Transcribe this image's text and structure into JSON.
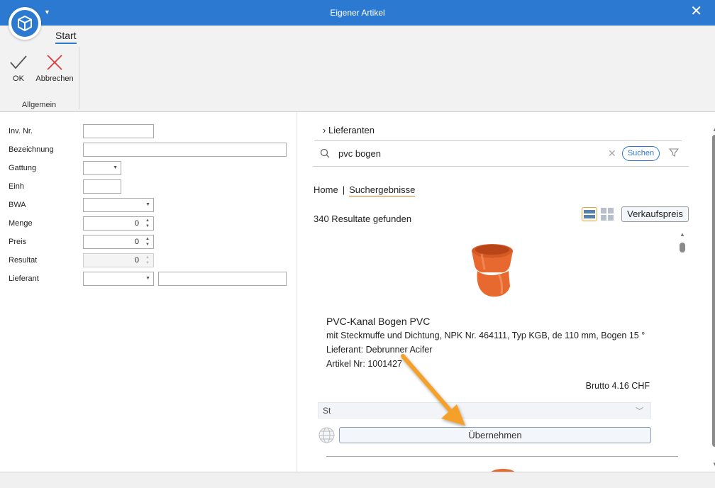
{
  "window": {
    "title": "Eigener Artikel"
  },
  "ribbon": {
    "tab": "Start",
    "ok_label": "OK",
    "cancel_label": "Abbrechen",
    "group_label": "Allgemein"
  },
  "form": {
    "inv_nr": {
      "label": "Inv. Nr.",
      "value": ""
    },
    "bezeichnung": {
      "label": "Bezeichnung",
      "value": ""
    },
    "gattung": {
      "label": "Gattung",
      "value": ""
    },
    "einh": {
      "label": "Einh",
      "value": ""
    },
    "bwa": {
      "label": "BWA",
      "value": ""
    },
    "menge": {
      "label": "Menge",
      "value": "0"
    },
    "preis": {
      "label": "Preis",
      "value": "0"
    },
    "resultat": {
      "label": "Resultat",
      "value": "0"
    },
    "lieferant": {
      "label": "Lieferant",
      "value": "",
      "extra": ""
    }
  },
  "search": {
    "lieferanten_label": "Lieferanten",
    "query": "pvc bogen",
    "button_label": "Suchen"
  },
  "breadcrumb": {
    "home": "Home",
    "separator": "|",
    "current": "Suchergebnisse"
  },
  "results": {
    "count_text": "340 Resultate gefunden",
    "price_mode_label": "Verkaufspreis"
  },
  "product": {
    "name": "PVC-Kanal Bogen PVC",
    "description": "mit Steckmuffe und Dichtung, NPK Nr. 464111, Typ KGB, de 110 mm, Bogen 15 °",
    "supplier": "Lieferant: Debrunner Acifer",
    "article": "Artikel Nr: 1001427",
    "price": "Brutto 4.16 CHF",
    "unit": "St",
    "take_over_label": "Übernehmen"
  },
  "icons": {
    "app": "box-icon",
    "close": "close-icon",
    "ok": "checkmark-icon",
    "cancel": "x-icon",
    "search": "search-icon",
    "filter": "filter-icon",
    "globe": "globe-icon"
  },
  "colors": {
    "accent": "#2b79d0",
    "highlight": "#e07a2b",
    "arrow": "#f5a02a",
    "pipe": "#e8692f"
  }
}
